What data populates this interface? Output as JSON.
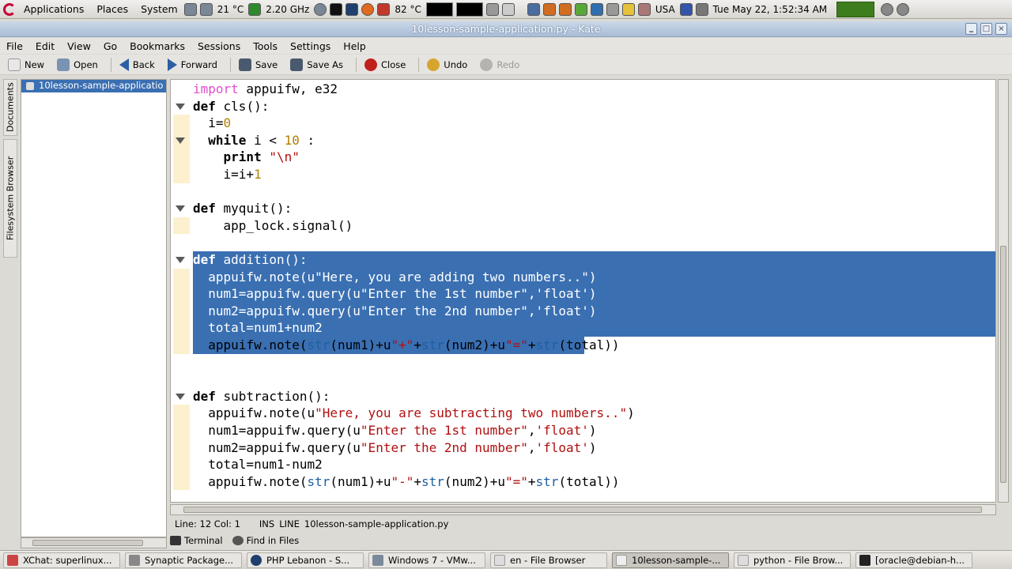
{
  "top_panel": {
    "menus": [
      "Applications",
      "Places",
      "System"
    ],
    "temp1": "21 °C",
    "cpu_freq": "2.20 GHz",
    "temp2": "82 °C",
    "keyboard": "USA",
    "clock": "Tue May 22,  1:52:34 AM"
  },
  "window": {
    "title": "10lesson-sample-application.py - Kate"
  },
  "menubar": [
    "File",
    "Edit",
    "View",
    "Go",
    "Bookmarks",
    "Sessions",
    "Tools",
    "Settings",
    "Help"
  ],
  "toolbar": {
    "new": "New",
    "open": "Open",
    "back": "Back",
    "forward": "Forward",
    "save": "Save",
    "save_as": "Save As",
    "close": "Close",
    "undo": "Undo",
    "redo": "Redo"
  },
  "sidebar": {
    "tab_documents": "Documents",
    "tab_filesystem": "Filesystem Browser",
    "documents": [
      "10lesson-sample-applicatio"
    ]
  },
  "status": {
    "position": "Line: 12 Col: 1",
    "mode": "INS",
    "selection_mode": "LINE",
    "filename": "10lesson-sample-application.py"
  },
  "tool_tabs": [
    "Terminal",
    "Find in Files"
  ],
  "taskbar": [
    "XChat: superlinux...",
    "Synaptic Package...",
    "PHP Lebanon - S...",
    "Windows 7 - VMw...",
    "en - File Browser",
    "10lesson-sample-...",
    "python - File Brow...",
    "[oracle@debian-h..."
  ],
  "code": [
    "import appuifw, e32",
    "def cls():",
    "  i=0",
    "  while i < 10 :",
    "    print \"\\n\"",
    "    i=i+1",
    "",
    "def myquit():",
    "    app_lock.signal()",
    "",
    "def addition():",
    "  appuifw.note(u\"Here, you are adding two numbers..\")",
    "  num1=appuifw.query(u\"Enter the 1st number\",'float')",
    "  num2=appuifw.query(u\"Enter the 2nd number\",'float')",
    "  total=num1+num2",
    "  appuifw.note(str(num1)+u\"+\"+str(num2)+u\"=\"+str(total))",
    "",
    "",
    "def subtraction():",
    "  appuifw.note(u\"Here, you are subtracting two numbers..\")",
    "  num1=appuifw.query(u\"Enter the 1st number\",'float')",
    "  num2=appuifw.query(u\"Enter the 2nd number\",'float')",
    "  total=num1-num2",
    "  appuifw.note(str(num1)+u\"-\"+str(num2)+u\"=\"+str(total))"
  ],
  "colors": {
    "selection": "#3a6fb2",
    "keyword_import": "#e14fd0",
    "number": "#b08000",
    "string": "#b01010",
    "builtin": "#1d5fa3"
  }
}
